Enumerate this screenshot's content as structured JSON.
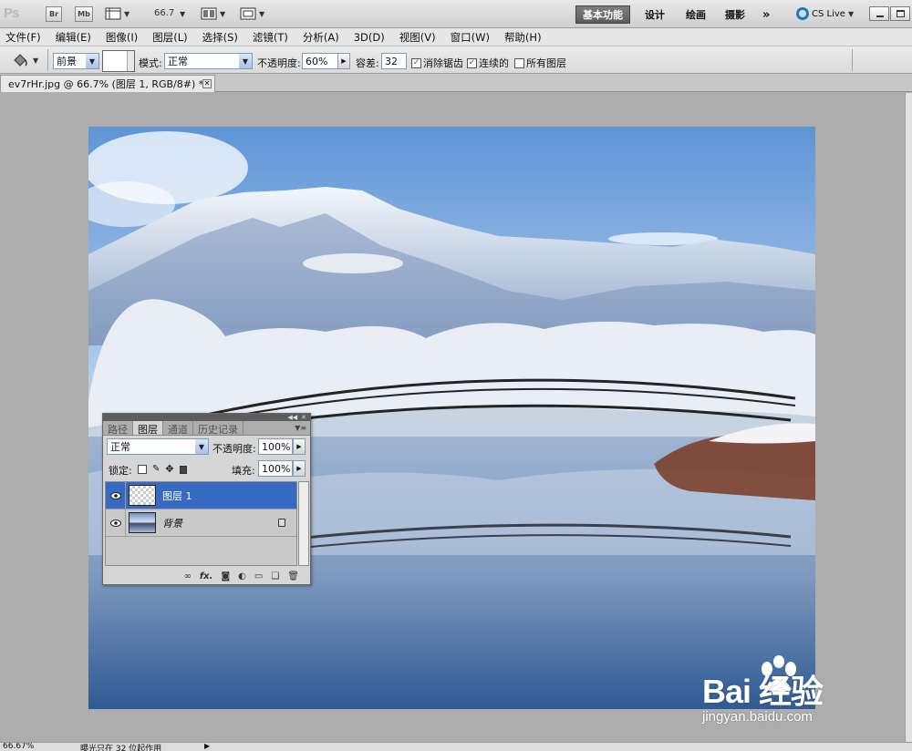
{
  "app": {
    "logo": "Ps",
    "bridge_label": "Br",
    "minibridge_label": "Mb",
    "zoom": "66.7",
    "workspaces": [
      "基本功能",
      "设计",
      "绘画",
      "摄影"
    ],
    "more_label": "»",
    "cslive_label": "CS Live"
  },
  "menu": [
    "文件(F)",
    "编辑(E)",
    "图像(I)",
    "图层(L)",
    "选择(S)",
    "滤镜(T)",
    "分析(A)",
    "3D(D)",
    "视图(V)",
    "窗口(W)",
    "帮助(H)"
  ],
  "options": {
    "fill_source": "前景",
    "mode_label": "模式:",
    "mode_value": "正常",
    "opacity_label": "不透明度:",
    "opacity_value": "60%",
    "tolerance_label": "容差:",
    "tolerance_value": "32",
    "antialias_label": "消除锯齿",
    "antialias_checked": true,
    "contiguous_label": "连续的",
    "contiguous_checked": true,
    "all_layers_label": "所有图层",
    "all_layers_checked": false
  },
  "document": {
    "tab_title": "ev7rHr.jpg @ 66.7% (图层 1, RGB/8#) *"
  },
  "layers_panel": {
    "tabs": [
      "路径",
      "图层",
      "通道",
      "历史记录"
    ],
    "active_tab": "图层",
    "blend_mode": "正常",
    "opacity_label": "不透明度:",
    "opacity_value": "100%",
    "lock_label": "锁定:",
    "fill_label": "填充:",
    "fill_value": "100%",
    "layers": [
      {
        "name": "图层 1",
        "selected": true,
        "visible": true,
        "locked": false
      },
      {
        "name": "背景",
        "selected": false,
        "visible": true,
        "locked": true
      }
    ],
    "bottom_icons": [
      "link-icon",
      "fx-icon",
      "mask-icon",
      "adjustment-icon",
      "group-icon",
      "new-layer-icon",
      "trash-icon"
    ]
  },
  "watermark": {
    "main": "Bai 经验",
    "sub": "jingyan.baidu.com"
  },
  "statusbar": {
    "zoom": "66.67%",
    "info": "曝光只在 32 位起作用"
  }
}
